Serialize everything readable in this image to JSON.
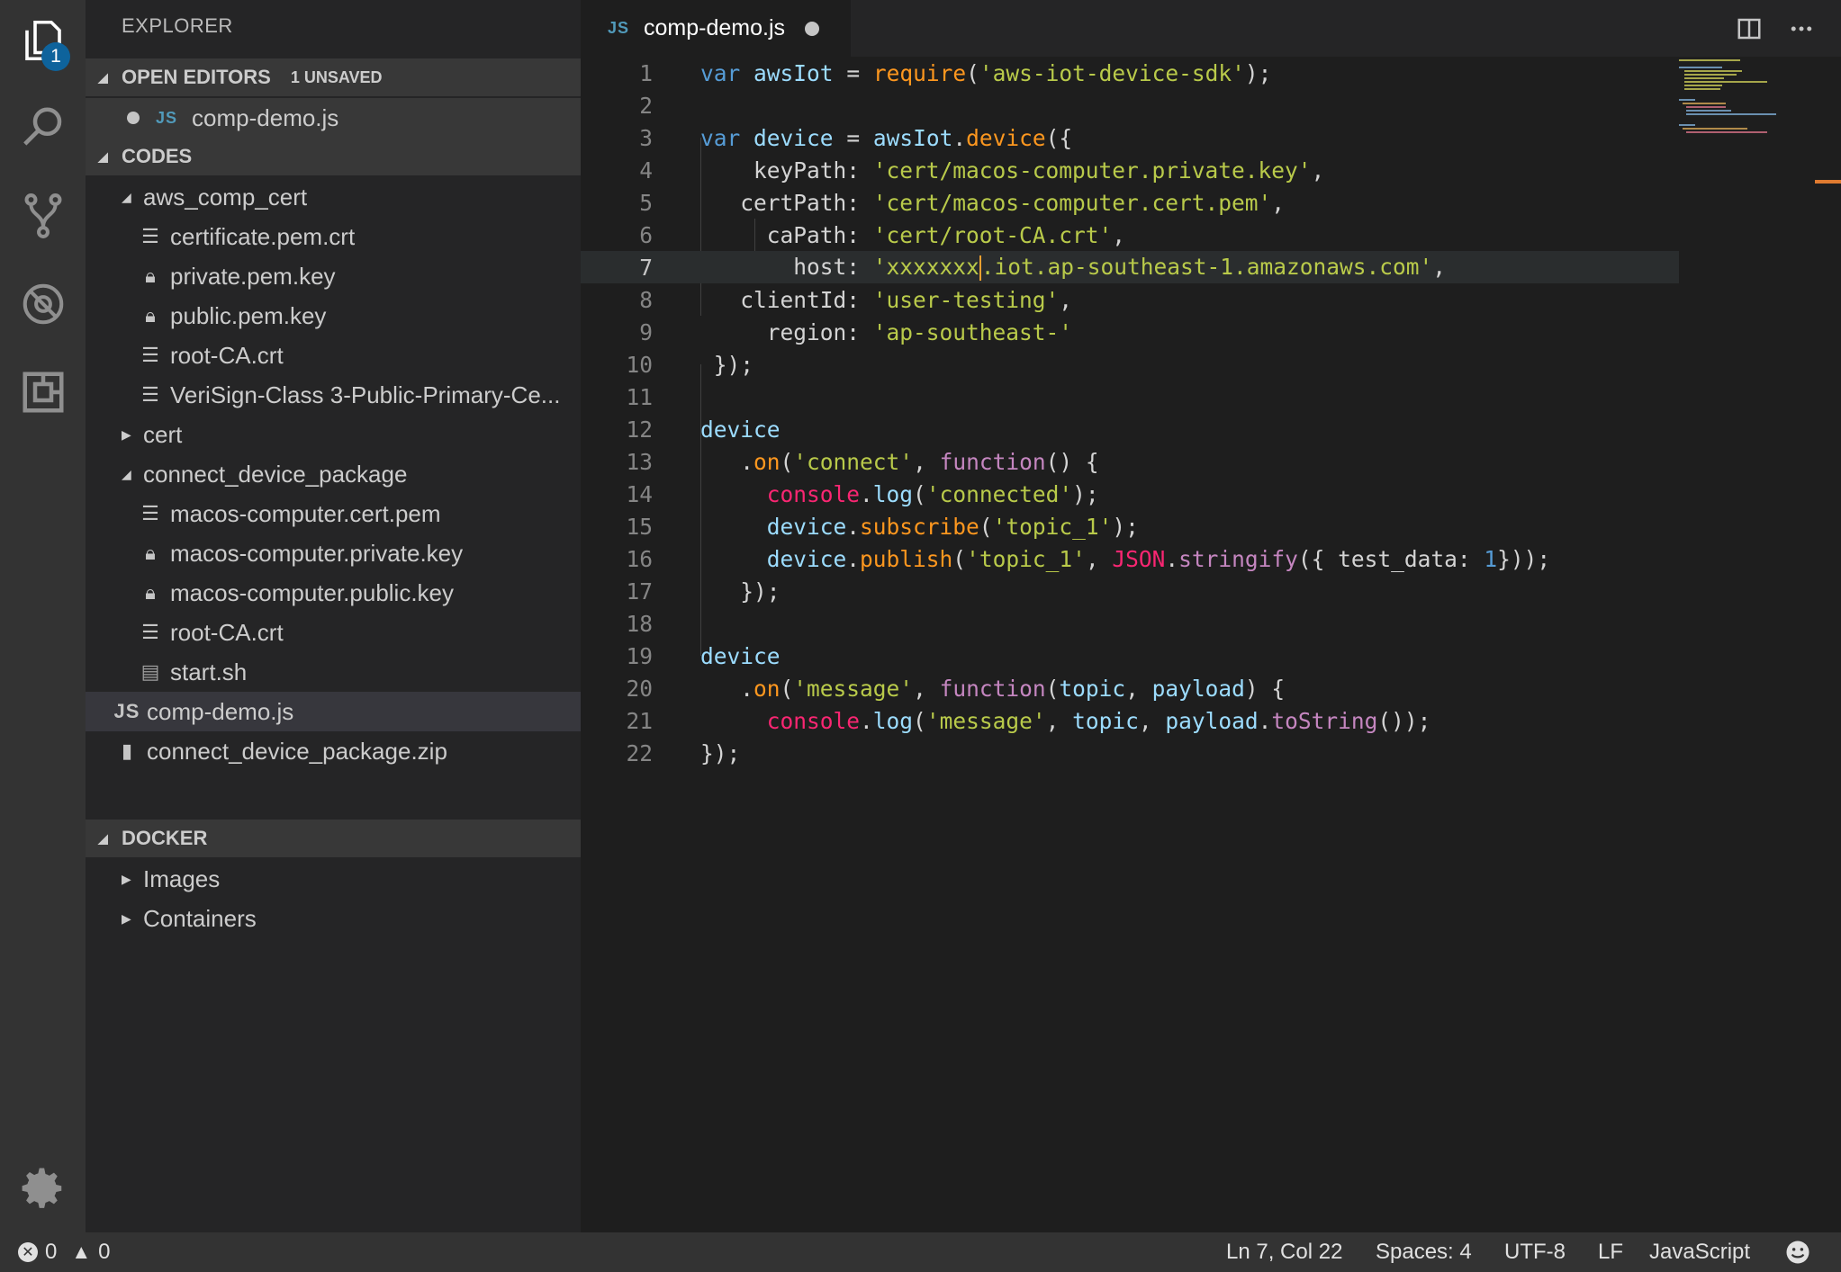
{
  "activity_bar": {
    "explorer_badge": "1",
    "icons": [
      "files-icon",
      "search-icon",
      "source-control-icon",
      "debug-icon",
      "extensions-icon",
      "gear-icon"
    ]
  },
  "sidebar": {
    "title": "EXPLORER",
    "open_editors": {
      "label": "OPEN EDITORS",
      "unsaved": "1 UNSAVED",
      "files": [
        {
          "name": "comp-demo.js",
          "type": "JS"
        }
      ]
    },
    "codes": {
      "label": "CODES",
      "items": [
        {
          "name": "aws_comp_cert",
          "kind": "folder-open"
        },
        {
          "name": "certificate.pem.crt",
          "kind": "file-lines"
        },
        {
          "name": "private.pem.key",
          "kind": "file-lock"
        },
        {
          "name": "public.pem.key",
          "kind": "file-lock"
        },
        {
          "name": "root-CA.crt",
          "kind": "file-lines"
        },
        {
          "name": "VeriSign-Class 3-Public-Primary-Ce...",
          "kind": "file-lines"
        },
        {
          "name": "cert",
          "kind": "folder-closed"
        },
        {
          "name": "connect_device_package",
          "kind": "folder-open"
        },
        {
          "name": "macos-computer.cert.pem",
          "kind": "file-lines"
        },
        {
          "name": "macos-computer.private.key",
          "kind": "file-lock"
        },
        {
          "name": "macos-computer.public.key",
          "kind": "file-lock"
        },
        {
          "name": "root-CA.crt",
          "kind": "file-lines"
        },
        {
          "name": "start.sh",
          "kind": "file-shell"
        },
        {
          "name": "comp-demo.js",
          "kind": "file-js"
        },
        {
          "name": "connect_device_package.zip",
          "kind": "file-zip"
        }
      ]
    },
    "docker": {
      "label": "DOCKER",
      "items": [
        "Images",
        "Containers"
      ]
    }
  },
  "editor": {
    "tab": {
      "name": "comp-demo.js",
      "type": "JS"
    },
    "line_numbers": [
      "1",
      "2",
      "3",
      "4",
      "5",
      "6",
      "7",
      "8",
      "9",
      "10",
      "11",
      "12",
      "13",
      "14",
      "15",
      "16",
      "17",
      "18",
      "19",
      "20",
      "21",
      "22"
    ]
  },
  "status_bar": {
    "errors": "0",
    "warnings": "0",
    "position": "Ln 7, Col 22",
    "spaces": "Spaces: 4",
    "encoding": "UTF-8",
    "eol": "LF",
    "language": "JavaScript"
  },
  "colors": {
    "activity_bar": "#333333",
    "sidebar": "#252526",
    "editor": "#1e1e1e",
    "badge": "#0e639c",
    "lock": "#8bc34a",
    "js": "#519aba"
  }
}
